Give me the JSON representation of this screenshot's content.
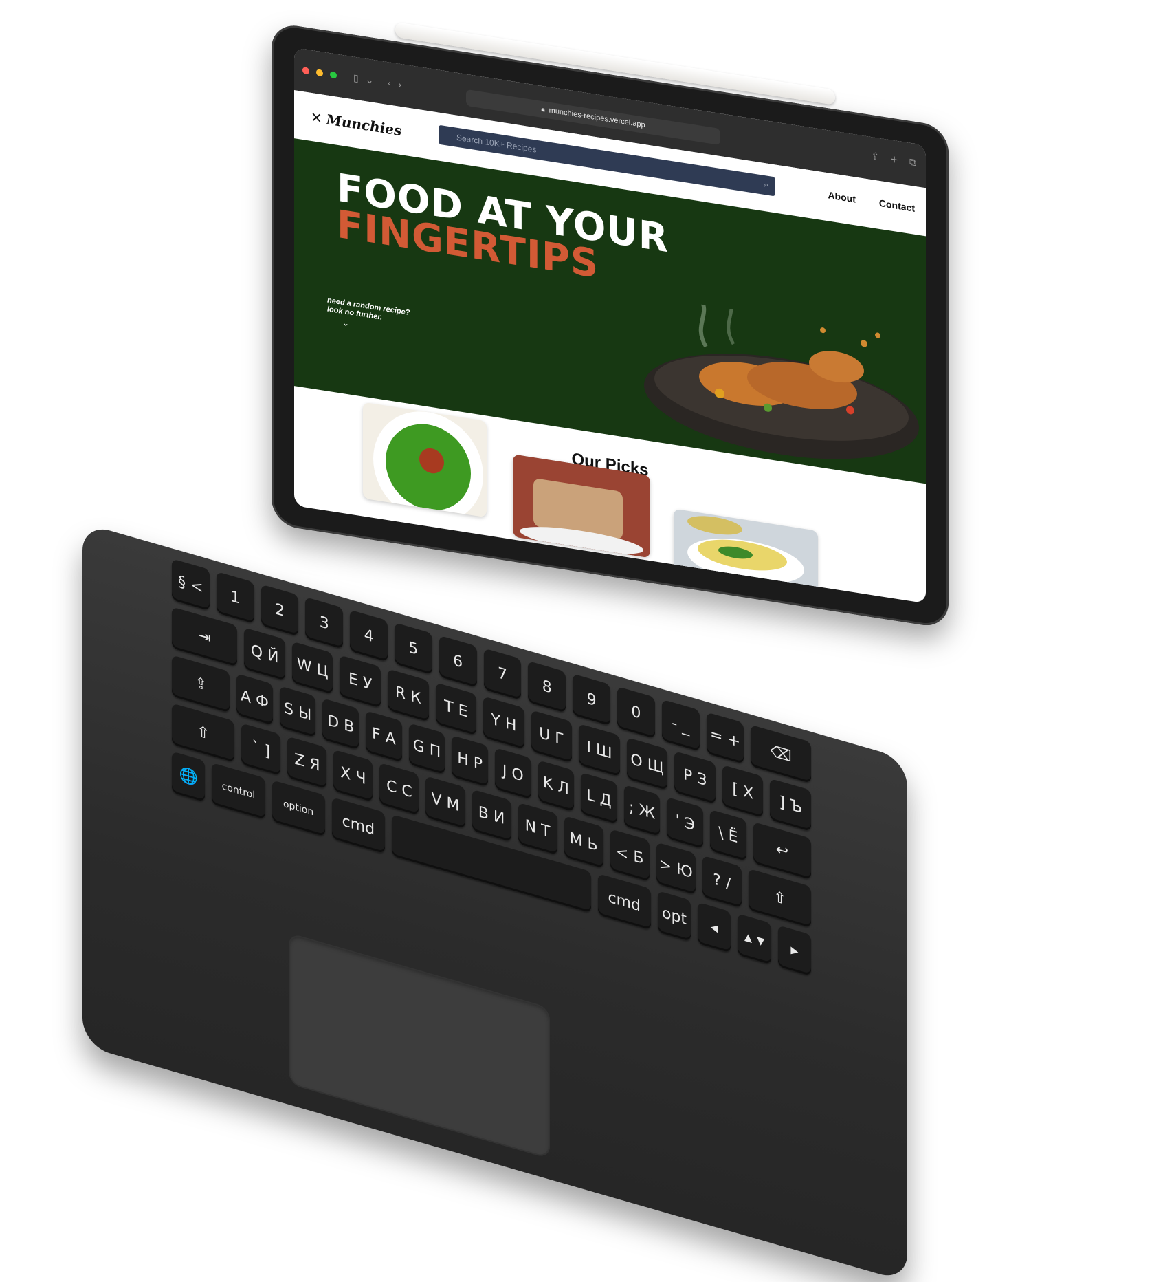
{
  "browser": {
    "url": "munchies-recipes.vercel.app"
  },
  "site": {
    "logo_text": "Munchies",
    "search_placeholder": "Search 10K+ Recipes",
    "nav": [
      "About",
      "Contact"
    ]
  },
  "hero": {
    "line1": "FOOD AT YOUR",
    "line2": "FINGERTIPS",
    "tagline_line1": "need a random recipe?",
    "tagline_line2": "look no further."
  },
  "picks": {
    "title": "Our Picks",
    "items": [
      {
        "icon": "spinach-dish-image"
      },
      {
        "icon": "oat-bar-image"
      },
      {
        "icon": "egg-frittata-image"
      }
    ]
  },
  "keyboard": {
    "rows": [
      [
        "§ <",
        "1",
        "2",
        "3",
        "4",
        "5",
        "6",
        "7",
        "8",
        "9",
        "0",
        "- _",
        "= +",
        "⌫"
      ],
      [
        "⇥",
        "Q Й",
        "W Ц",
        "E У",
        "R К",
        "T Е",
        "Y Н",
        "U Г",
        "I Ш",
        "O Щ",
        "P З",
        "[ Х",
        "] Ъ"
      ],
      [
        "⇪",
        "A Ф",
        "S Ы",
        "D В",
        "F А",
        "G П",
        "H Р",
        "J О",
        "K Л",
        "L Д",
        "; Ж",
        "' Э",
        "\\ Ё",
        "↩"
      ],
      [
        "⇧",
        "` ]",
        "Z Я",
        "X Ч",
        "C С",
        "V М",
        "B И",
        "N Т",
        "M Ь",
        "< Б",
        "> Ю",
        "? /",
        "⇧"
      ],
      [
        "🌐",
        "control",
        "option",
        "cmd",
        "",
        "cmd",
        "opt",
        "◂",
        "▴ ▾",
        "▸"
      ]
    ]
  },
  "colors": {
    "hero_bg": "#173812",
    "accent": "#d25a35",
    "search_bg": "#2f3b54"
  }
}
